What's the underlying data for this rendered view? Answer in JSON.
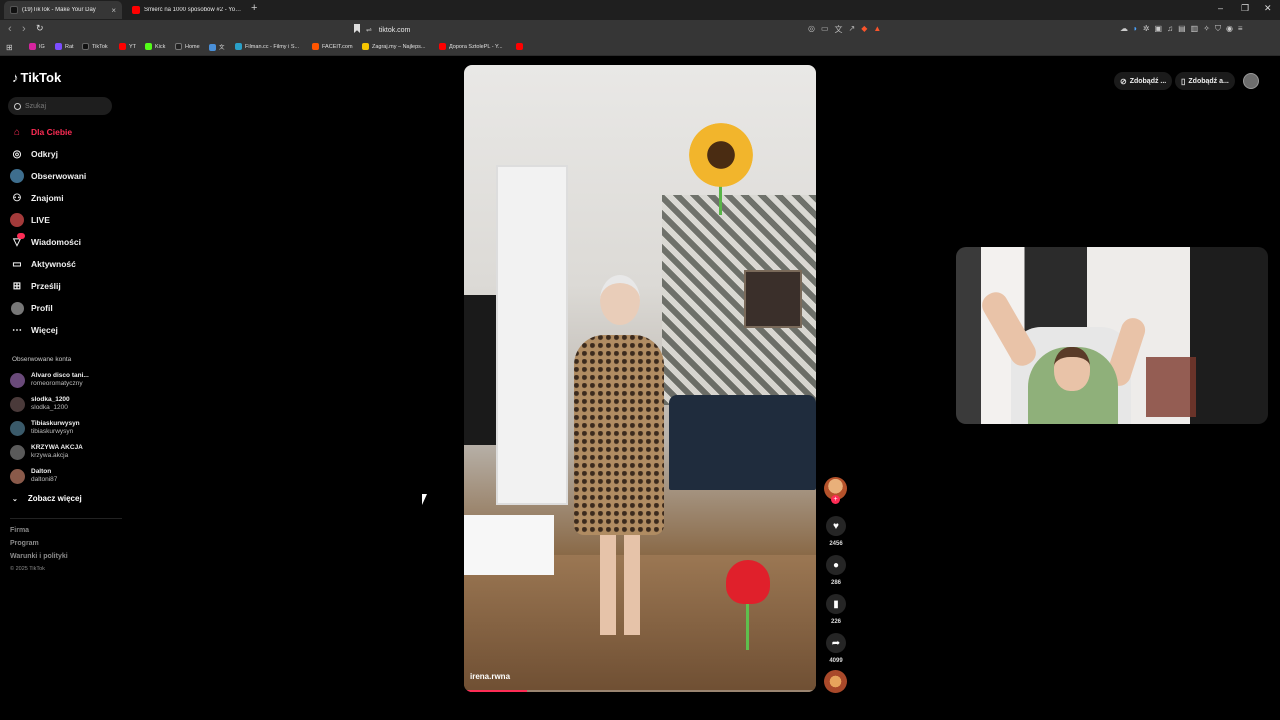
{
  "browser": {
    "tabs": [
      {
        "title": "(19)TikTok - Make Your Day",
        "active": true
      },
      {
        "title": "Śmierć na 1000 sposobów #2 - YouTube",
        "active": false
      }
    ],
    "url": "tiktok.com",
    "bookmarks": [
      {
        "label": "IG",
        "color": "#d6249f"
      },
      {
        "label": "Rat",
        "color": "#7c4dff"
      },
      {
        "label": "TikTok",
        "color": "#111111"
      },
      {
        "label": "YT",
        "color": "#ff0000"
      },
      {
        "label": "Kick",
        "color": "#53fc18"
      },
      {
        "label": "Home",
        "color": "#222222"
      },
      {
        "label": "文",
        "color": "#4a90d9"
      },
      {
        "label": "Filman.cc - Filmy i S...",
        "color": "#2aa0c8"
      },
      {
        "label": "FACEIT.com",
        "color": "#ff5500"
      },
      {
        "label": "Zagraj.my – Najleps...",
        "color": "#f5c400"
      },
      {
        "label": "Дорога SztolePL - Y...",
        "color": "#ff0000"
      },
      {
        "label": "",
        "color": "#ff0000"
      }
    ]
  },
  "tiktok": {
    "logo": "TikTok",
    "search_placeholder": "Szukaj",
    "nav": [
      {
        "label": "Dla Ciebie",
        "icon": "home-icon",
        "active": true
      },
      {
        "label": "Odkryj",
        "icon": "compass-icon"
      },
      {
        "label": "Obserwowani",
        "icon": "following-avatar-icon"
      },
      {
        "label": "Znajomi",
        "icon": "friends-icon"
      },
      {
        "label": "LIVE",
        "icon": "live-avatar-icon"
      },
      {
        "label": "Wiadomości",
        "icon": "messages-icon"
      },
      {
        "label": "Aktywność",
        "icon": "activity-icon"
      },
      {
        "label": "Prześlij",
        "icon": "upload-icon"
      },
      {
        "label": "Profil",
        "icon": "profile-icon"
      },
      {
        "label": "Więcej",
        "icon": "more-icon"
      }
    ],
    "followed_title": "Obserwowane konta",
    "followed": [
      {
        "name": "Alvaro disco tani...",
        "handle": "romeoromatyczny"
      },
      {
        "name": "slodka_1200",
        "handle": "slodka_1200"
      },
      {
        "name": "Tibiaskurwysyn",
        "handle": "tibiaskurwysyn"
      },
      {
        "name": "KRZYWA AKCJA",
        "handle": "krzywa.akcja"
      },
      {
        "name": "Dalton",
        "handle": "daltoni87"
      }
    ],
    "see_more": "Zobacz więcej",
    "footer": {
      "firma": "Firma",
      "program": "Program",
      "terms": "Warunki i polityki",
      "copyright": "© 2025 TikTok"
    },
    "top_right": {
      "coins_label": "Zdobądź ...",
      "app_label": "Zdobądź a..."
    },
    "video": {
      "author": "irena.rwna",
      "progress_percent": 18,
      "likes": "2456",
      "comments": "286",
      "saves": "226",
      "shares": "4099"
    }
  }
}
